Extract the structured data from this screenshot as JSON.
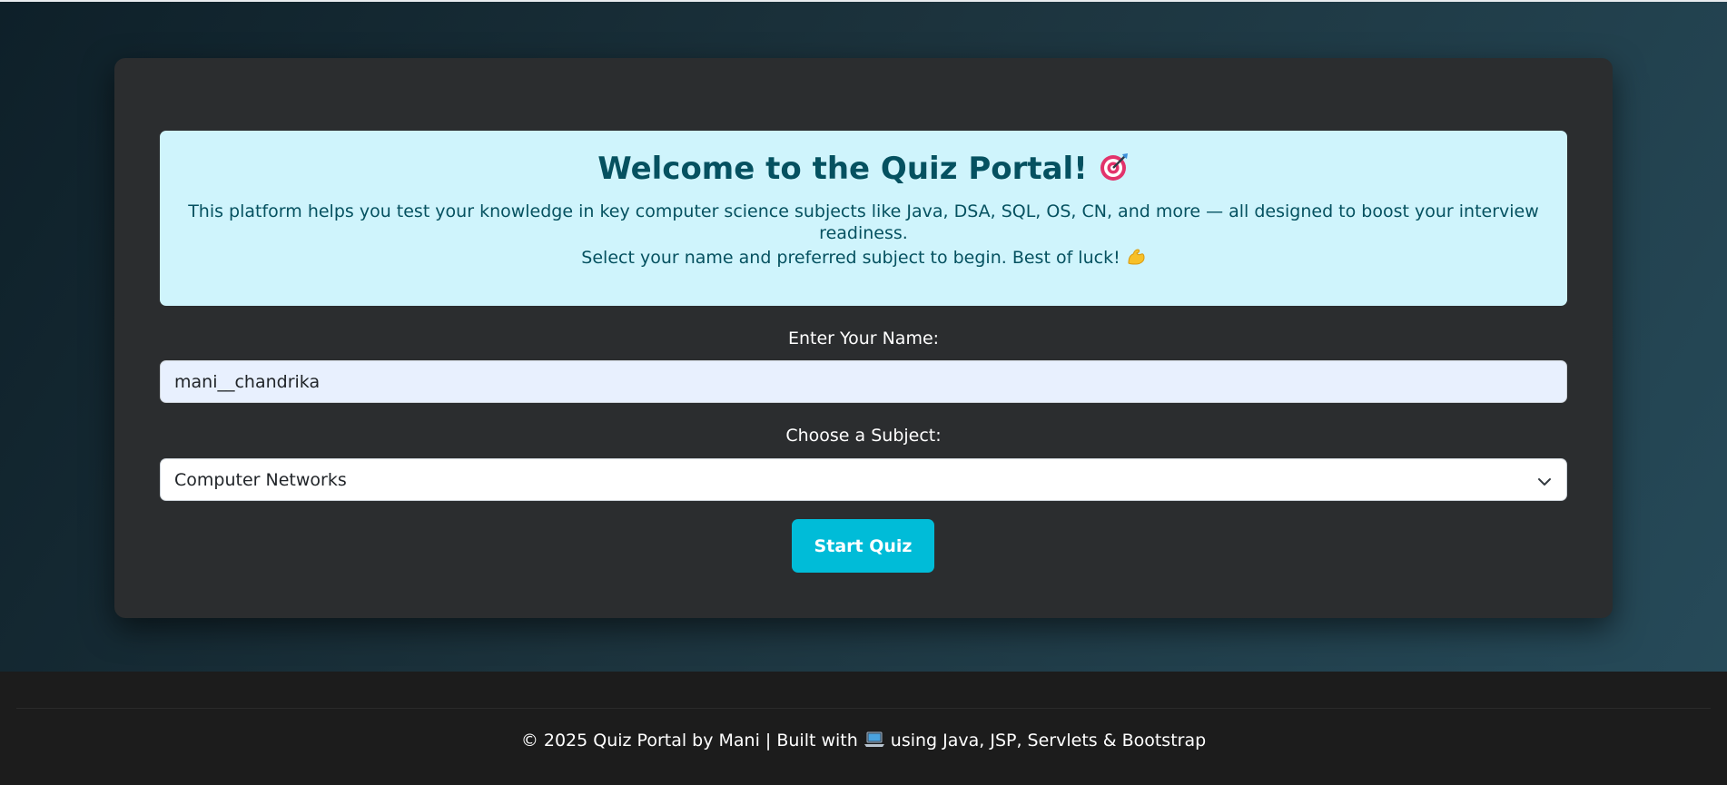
{
  "info": {
    "title": "Welcome to the Quiz Portal!",
    "description": "This platform helps you test your knowledge in key computer science subjects like Java, DSA, SQL, OS, CN, and more — all designed to boost your interview readiness.",
    "instruction": "Select your name and preferred subject to begin. Best of luck!"
  },
  "form": {
    "name_label": "Enter Your Name:",
    "name_value": "mani__chandrika",
    "subject_label": "Choose a Subject:",
    "subject_selected": "Computer Networks",
    "start_button": "Start Quiz"
  },
  "footer": {
    "text_before_icon": "© 2025 Quiz Portal by Mani | Built with",
    "text_after_icon": "using Java, JSP, Servlets & Bootstrap"
  },
  "colors": {
    "info_background": "#cff4fc",
    "info_text": "#055160",
    "card_background": "#2b2d2f",
    "button_background": "#00bcd8",
    "footer_background": "#1c1c1c"
  },
  "icons": {
    "title_icon": "target-icon",
    "instruction_icon": "flexed-biceps-icon",
    "footer_icon": "laptop-icon",
    "select_icon": "chevron-down-icon"
  }
}
